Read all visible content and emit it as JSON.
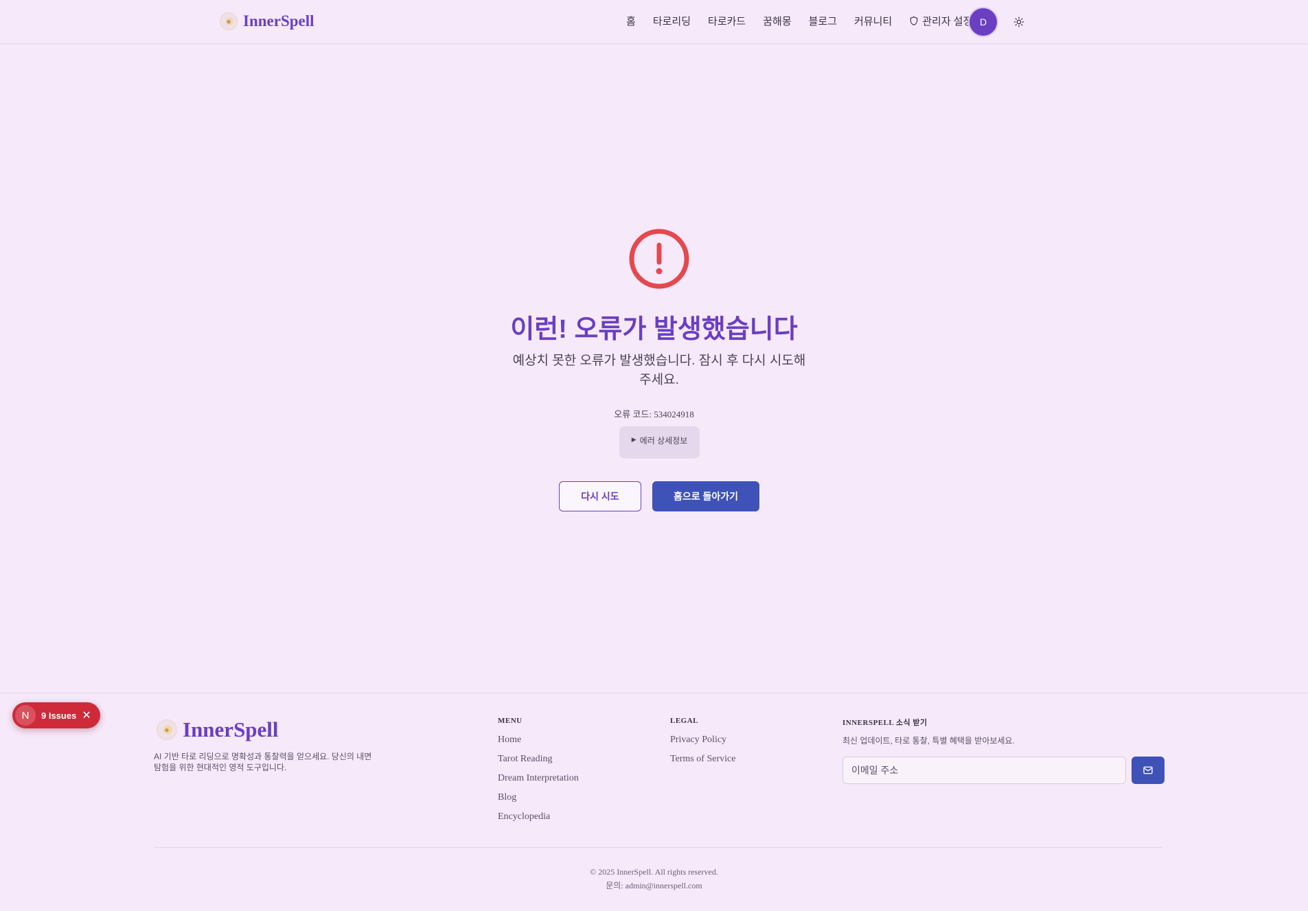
{
  "header": {
    "logo_text": "InnerSpell",
    "nav": [
      "홈",
      "타로리딩",
      "타로카드",
      "꿈해몽",
      "블로그",
      "커뮤니티"
    ],
    "admin_label": "관리자 설정",
    "avatar_initial": "D",
    "theme_icon": "sun-icon"
  },
  "error": {
    "icon": "alert-circle-icon",
    "title": "이런! 오류가 발생했습니다",
    "description": "예상치 못한 오류가 발생했습니다. 잠시 후 다시 시도해주세요.",
    "code_label": "오류 코드: 534024918",
    "details_label": "에러 상세정보",
    "retry_label": "다시 시도",
    "home_label": "홈으로 돌아가기"
  },
  "issues": {
    "n_letter": "N",
    "label": "9 Issues"
  },
  "footer": {
    "logo_text": "InnerSpell",
    "tagline": "AI 기반 타로 리딩으로 명확성과 통찰력을 얻으세요. 당신의 내면 탐험을 위한 현대적인 영적 도구입니다.",
    "menu": {
      "title": "MENU",
      "items": [
        "Home",
        "Tarot Reading",
        "Dream Interpretation",
        "Blog",
        "Encyclopedia"
      ]
    },
    "legal": {
      "title": "LEGAL",
      "items": [
        "Privacy Policy",
        "Terms of Service"
      ]
    },
    "newsletter": {
      "title": "INNERSPELL 소식 받기",
      "description": "최신 업데이트, 타로 통찰, 특별 혜택을 받아보세요.",
      "placeholder": "이메일 주소",
      "button_icon": "mail-icon"
    },
    "copyright": "© 2025 InnerSpell. All rights reserved.",
    "contact": "문의: admin@innerspell.com"
  },
  "colors": {
    "accent": "#6a3fc2",
    "primary_button": "#3e52b8",
    "error": "#e5484d",
    "background": "#f6e9fa"
  }
}
